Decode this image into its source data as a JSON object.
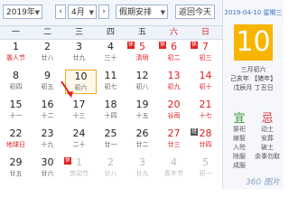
{
  "toolbar": {
    "year": "2019年",
    "month": "4月",
    "holiday": "假期安排",
    "today_button": "返回今天",
    "prev": "‹",
    "next": "›"
  },
  "weekdays": [
    "一",
    "二",
    "三",
    "四",
    "五",
    "六",
    "日"
  ],
  "days": [
    [
      {
        "n": "1",
        "l": "愚人节"
      },
      {
        "n": "2",
        "l": "廿八"
      },
      {
        "n": "3",
        "l": "廿九"
      },
      {
        "n": "4",
        "l": "三十"
      },
      {
        "n": "5",
        "l": "清明"
      },
      {
        "n": "6",
        "l": "初二"
      },
      {
        "n": "7",
        "l": "初三"
      }
    ],
    [
      {
        "n": "8",
        "l": "初四"
      },
      {
        "n": "9",
        "l": "初五"
      },
      {
        "n": "10",
        "l": "初六"
      },
      {
        "n": "11",
        "l": "初七"
      },
      {
        "n": "12",
        "l": "初八"
      },
      {
        "n": "13",
        "l": "初九"
      },
      {
        "n": "14",
        "l": "初十"
      }
    ],
    [
      {
        "n": "15",
        "l": "十一"
      },
      {
        "n": "16",
        "l": "十二"
      },
      {
        "n": "17",
        "l": "十三"
      },
      {
        "n": "18",
        "l": "十四"
      },
      {
        "n": "19",
        "l": "十五"
      },
      {
        "n": "20",
        "l": "谷雨"
      },
      {
        "n": "21",
        "l": "十七"
      }
    ],
    [
      {
        "n": "22",
        "l": "地球日"
      },
      {
        "n": "23",
        "l": "十九"
      },
      {
        "n": "24",
        "l": "二十"
      },
      {
        "n": "25",
        "l": "廿一"
      },
      {
        "n": "26",
        "l": "廿二"
      },
      {
        "n": "27",
        "l": "廿三"
      },
      {
        "n": "28",
        "l": "廿四"
      }
    ],
    [
      {
        "n": "29",
        "l": "廿五"
      },
      {
        "n": "30",
        "l": "廿六"
      },
      {
        "n": "1",
        "l": "劳动节"
      },
      {
        "n": "2",
        "l": "廿八"
      },
      {
        "n": "3",
        "l": "廿九"
      },
      {
        "n": "4",
        "l": "青年节"
      },
      {
        "n": "5",
        "l": "初一"
      }
    ]
  ],
  "tags": {
    "rest": "休",
    "work": "班"
  },
  "side": {
    "date": "2019-04-10 星期三",
    "day": "10",
    "lunar_month": "三月初六",
    "ganzhi_year": "己亥年 【猪年】",
    "ganzhi_month_day": "戊辰月 丁丑日",
    "yi_title": "宜",
    "ji_title": "忌",
    "yi": [
      "祭祀",
      "嫁娶",
      "入殓",
      "除服",
      "成服"
    ],
    "ji": [
      "动土",
      "安葬",
      "破土",
      "余事勿取"
    ]
  },
  "watermark": "360 图片"
}
